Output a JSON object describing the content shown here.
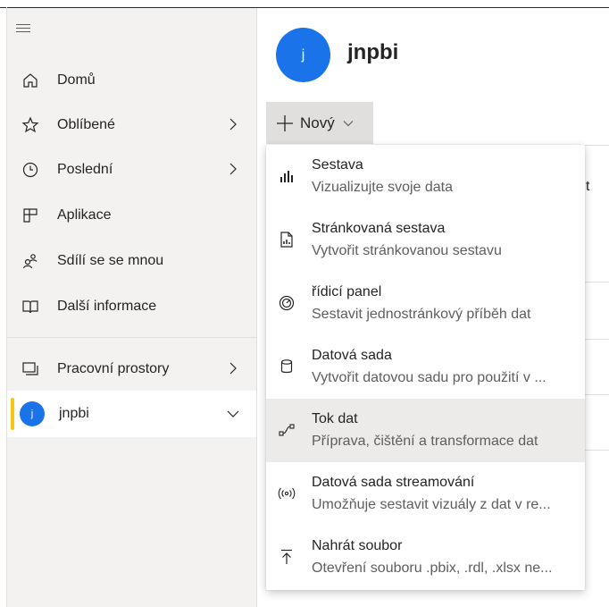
{
  "sidebar": {
    "items": [
      {
        "label": "Domů",
        "icon": "home-icon"
      },
      {
        "label": "Oblíbené",
        "icon": "star-icon"
      },
      {
        "label": "Poslední",
        "icon": "clock-icon"
      },
      {
        "label": "Aplikace",
        "icon": "apps-icon"
      },
      {
        "label": "Sdílí se se mnou",
        "icon": "shared-icon"
      },
      {
        "label": "Další informace",
        "icon": "book-icon"
      }
    ],
    "workspaces_label": "Pracovní prostory",
    "current_workspace": {
      "label": "jnpbi",
      "avatar_letter": "j"
    }
  },
  "main": {
    "workspace_title": "jnpbi",
    "avatar_letter": "j",
    "new_button_label": "Nový",
    "background_fragment": "t"
  },
  "menu": {
    "items": [
      {
        "title": "Sestava",
        "desc": "Vizualizujte svoje data"
      },
      {
        "title": "Stránkovaná sestava",
        "desc": "Vytvořit stránkovanou sestavu"
      },
      {
        "title": "řídicí panel",
        "desc": "Sestavit jednostránkový příběh dat"
      },
      {
        "title": "Datová sada",
        "desc": "Vytvořit datovou sadu pro použití v ..."
      },
      {
        "title": "Tok dat",
        "desc": "Příprava, čištění a transformace dat"
      },
      {
        "title": "Datová sada streamování",
        "desc": "Umožňuje sestavit vizuály z dat v re..."
      },
      {
        "title": "Nahrát soubor",
        "desc": "Otevření souboru .pbix, .rdl, .xlsx ne..."
      }
    ]
  },
  "colors": {
    "accent": "#1a73e8",
    "selection_bar": "#f2c811",
    "sidebar_bg": "#f3f2f1",
    "hover_bg": "#edebe9"
  }
}
